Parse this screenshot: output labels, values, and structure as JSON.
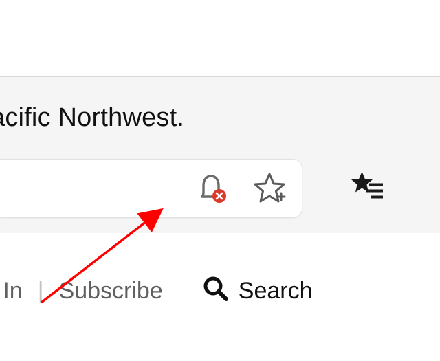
{
  "content": {
    "headline_fragment": "acific Northwest."
  },
  "nav": {
    "login_fragment": "g In",
    "subscribe": "Subscribe",
    "search": "Search"
  },
  "icons": {
    "bell": "bell-icon",
    "bell_badge": "error-badge",
    "star_add": "star-add-icon",
    "star_list": "star-list-icon",
    "magnifier": "search-icon"
  },
  "colors": {
    "badge": "#d93a2b",
    "icon": "#5a5a5a",
    "text_gray": "#606060"
  }
}
